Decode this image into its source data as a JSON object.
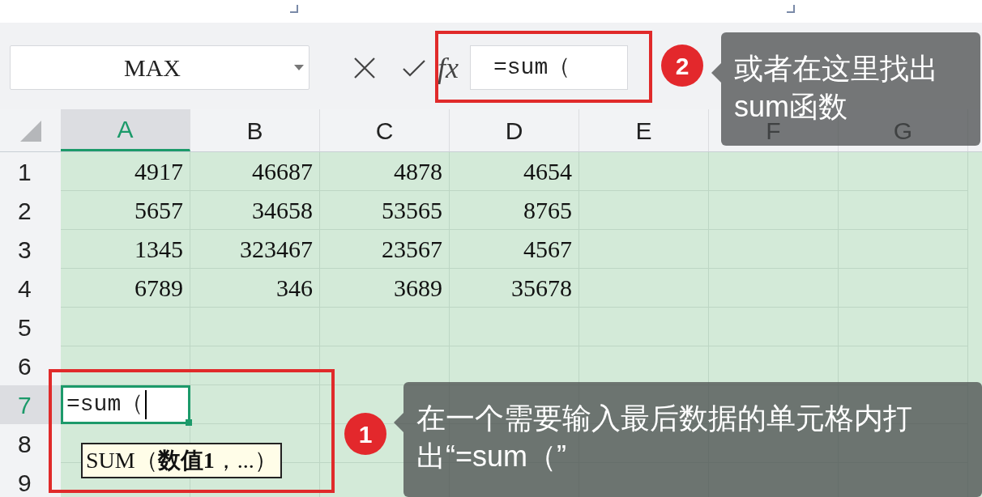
{
  "name_box": {
    "value": "MAX"
  },
  "formula_bar": {
    "function_label": "fx",
    "value": "=sum（"
  },
  "columns": [
    {
      "label": "A",
      "selected": true
    },
    {
      "label": "B",
      "selected": false
    },
    {
      "label": "C",
      "selected": false
    },
    {
      "label": "D",
      "selected": false
    },
    {
      "label": "E",
      "selected": false
    },
    {
      "label": "F",
      "selected": false
    },
    {
      "label": "G",
      "selected": false
    }
  ],
  "rows": [
    {
      "label": "1",
      "selected": false,
      "cells": [
        "4917",
        "46687",
        "4878",
        "4654"
      ]
    },
    {
      "label": "2",
      "selected": false,
      "cells": [
        "5657",
        "34658",
        "53565",
        "8765"
      ]
    },
    {
      "label": "3",
      "selected": false,
      "cells": [
        "1345",
        "323467",
        "23567",
        "4567"
      ]
    },
    {
      "label": "4",
      "selected": false,
      "cells": [
        "6789",
        "346",
        "3689",
        "35678"
      ]
    },
    {
      "label": "5",
      "selected": false,
      "cells": []
    },
    {
      "label": "6",
      "selected": false,
      "cells": []
    },
    {
      "label": "7",
      "selected": true,
      "cells": [],
      "editing": "=sum（"
    },
    {
      "label": "8",
      "selected": false,
      "cells": []
    },
    {
      "label": "9",
      "selected": false,
      "cells": []
    }
  ],
  "autocomplete": {
    "text": "SUM（**数值1**，...）"
  },
  "callouts": [
    {
      "number": "2",
      "text": "或者在这里找出sum函数"
    },
    {
      "number": "1",
      "text": "在一个需要输入最后数据的单元格内打出“=sum（”"
    }
  ]
}
